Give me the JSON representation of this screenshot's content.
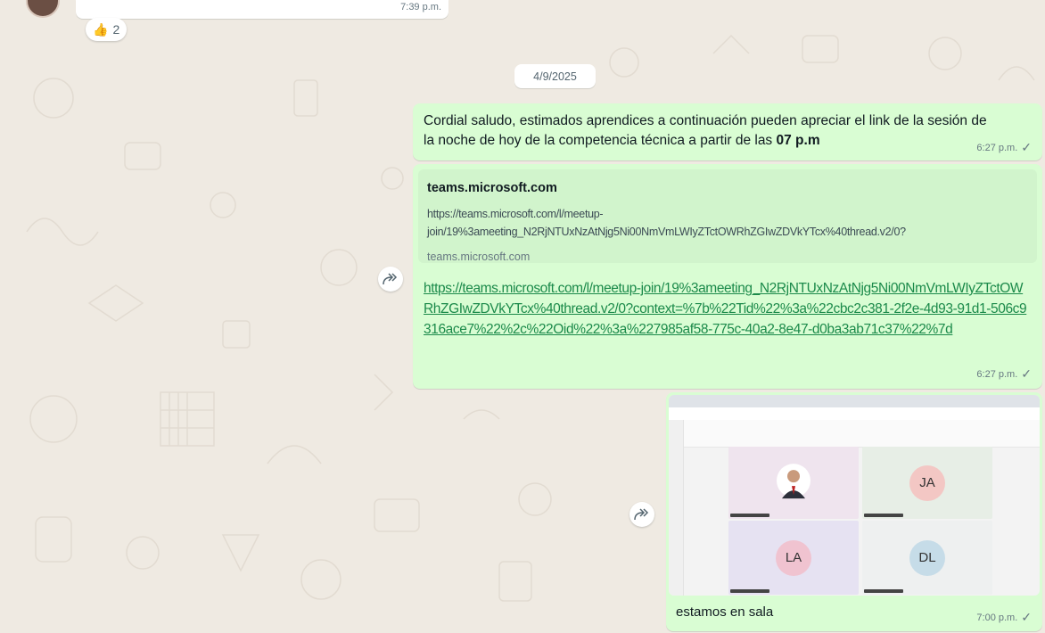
{
  "previous_message": {
    "time": "7:39 p.m."
  },
  "reaction": {
    "emoji": "👍",
    "count": "2"
  },
  "date_separator": "4/9/2025",
  "messages": [
    {
      "text_before": "Cordial saludo, estimados aprendices a continuación pueden apreciar el link de la sesión de la noche de hoy de la competencia técnica a partir de las ",
      "text_bold": "07 p.m",
      "time": "6:27 p.m."
    },
    {
      "preview_title": "teams.microsoft.com",
      "preview_description": "https://teams.microsoft.com/l/meetup-join/19%3ameeting_N2RjNTUxNzAtNjg5Ni00NmVmLWIyZTctOWRhZGIwZDVkYTcx%40thread.v2/0?",
      "preview_domain": "teams.microsoft.com",
      "link": "https://teams.microsoft.com/l/meetup-join/19%3ameeting_N2RjNTUxNzAtNjg5Ni00NmVmLWIyZTctOWRhZGIwZDVkYTcx%40thread.v2/0?context=%7b%22Tid%22%3a%22cbc2c381-2f2e-4d93-91d1-506c9316ace7%22%2c%22Oid%22%3a%227985af58-775c-40a2-8e47-d0ba3ab71c37%22%7d",
      "time": "6:27 p.m."
    },
    {
      "image": {
        "tiles": [
          {
            "initials": ""
          },
          {
            "initials": "JA"
          },
          {
            "initials": "LA"
          },
          {
            "initials": "DL"
          }
        ]
      },
      "caption": "estamos en sala",
      "time": "7:00 p.m."
    }
  ],
  "status_icon": "single-check-icon",
  "forward_icon": "forward-arrow-icon",
  "colors": {
    "chat_background": "#efeae2",
    "outgoing_bubble": "#d9fdd3",
    "link": "#1b8a4a",
    "meta_text": "#667781"
  }
}
